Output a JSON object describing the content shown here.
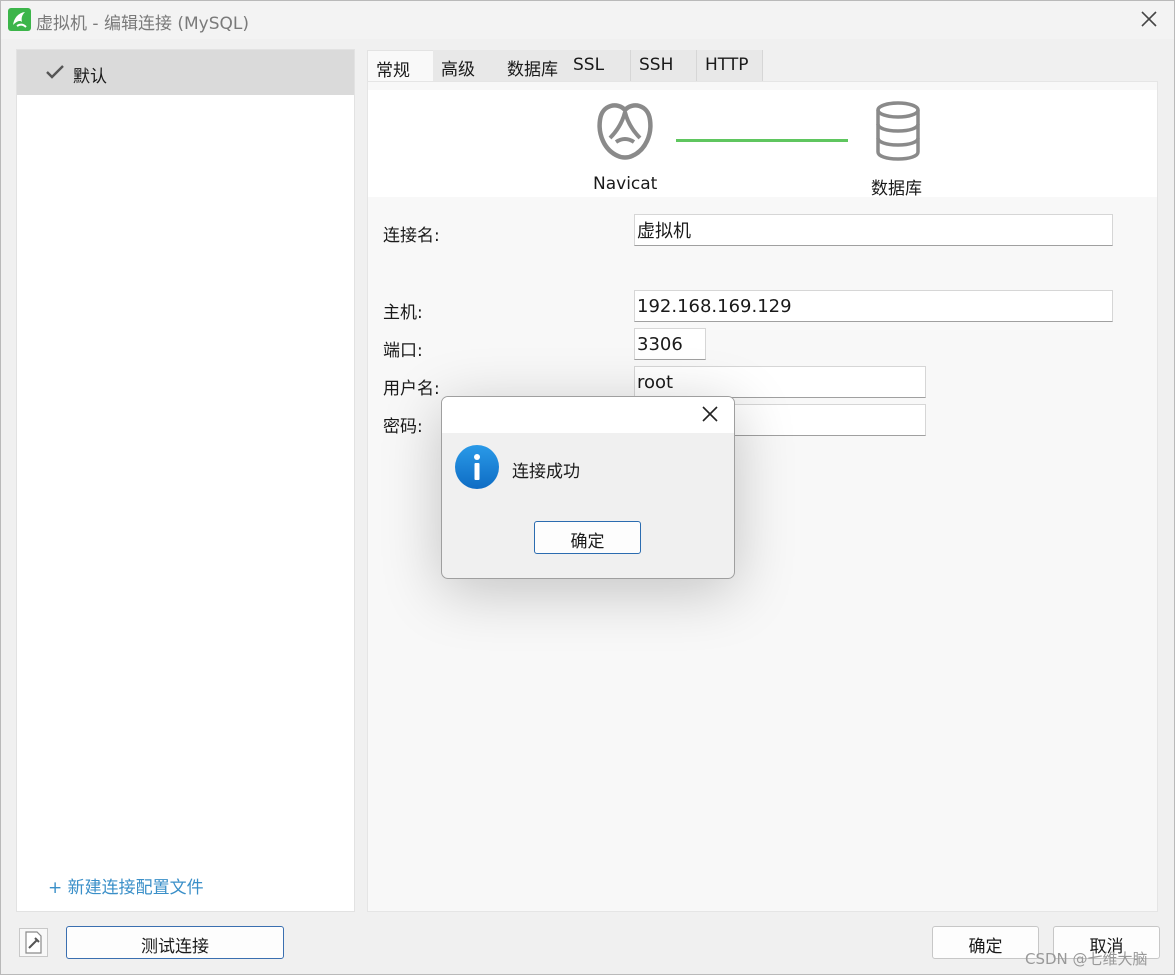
{
  "window": {
    "title": "虚拟机 - 编辑连接 (MySQL)",
    "icon": "navicat-app-icon",
    "close_icon": "close-icon"
  },
  "sidebar": {
    "profiles": [
      {
        "label": "默认",
        "selected": true
      }
    ],
    "new_profile_link": "+ 新建连接配置文件"
  },
  "tabs": [
    {
      "label": "常规",
      "active": true
    },
    {
      "label": "高级",
      "active": false
    },
    {
      "label": "数据库",
      "active": false
    },
    {
      "label": "SSL",
      "active": false
    },
    {
      "label": "SSH",
      "active": false
    },
    {
      "label": "HTTP",
      "active": false
    }
  ],
  "diagram": {
    "left_label": "Navicat",
    "right_label": "数据库",
    "line_color": "#5fc65f"
  },
  "form": {
    "connection_name": {
      "label": "连接名:",
      "value": "虚拟机"
    },
    "host": {
      "label": "主机:",
      "value": "192.168.169.129"
    },
    "port": {
      "label": "端口:",
      "value": "3306"
    },
    "username": {
      "label": "用户名:",
      "value": "root"
    },
    "password": {
      "label": "密码:",
      "value": ""
    }
  },
  "footer": {
    "test_button": "测试连接",
    "ok_button": "确定",
    "cancel_button": "取消",
    "watermark": "CSDN @七维大脑"
  },
  "dialog": {
    "message": "连接成功",
    "ok_button": "确定",
    "icon": "info-icon",
    "accent_color": "#1b7fd4"
  }
}
